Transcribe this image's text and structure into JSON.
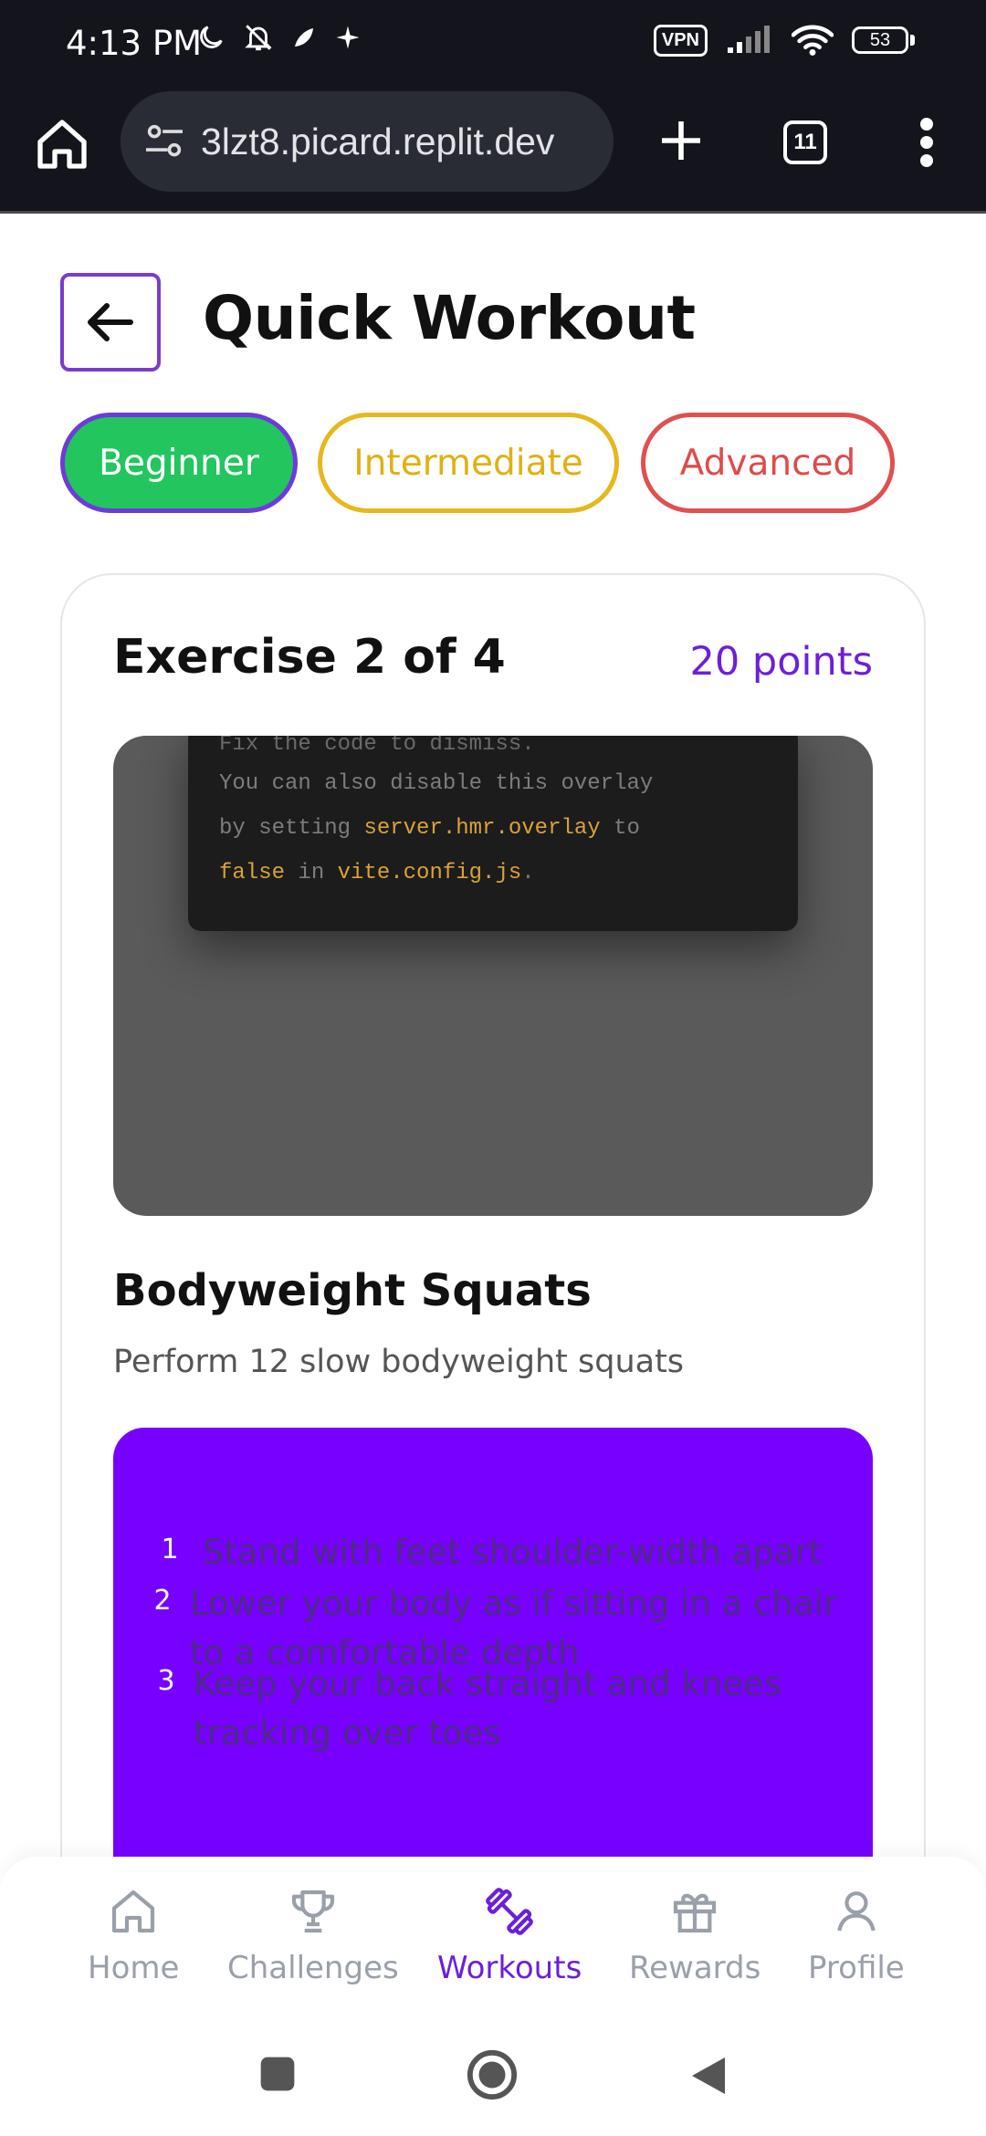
{
  "status_bar": {
    "time": "4:13 PM",
    "vpn_label": "VPN",
    "battery": "53",
    "icons": [
      "moon-icon",
      "bell-off-icon",
      "leaf-icon",
      "sparkle-icon",
      "signal-icon",
      "wifi-icon"
    ]
  },
  "browser": {
    "url": "3lzt8.picard.replit.dev",
    "tab_count": "11"
  },
  "page": {
    "title": "Quick Workout",
    "levels": [
      {
        "label": "Beginner",
        "selected": true,
        "color": "#22c55e"
      },
      {
        "label": "Intermediate",
        "selected": false,
        "color": "#e6b81c"
      },
      {
        "label": "Advanced",
        "selected": false,
        "color": "#e05050"
      }
    ]
  },
  "exercise": {
    "progress": "Exercise 2 of 4",
    "points": "20 points",
    "overlay": {
      "clipped_line": "Fix the code to dismiss.",
      "line1": "You can also disable this overlay",
      "line2_pre": "by setting ",
      "line2_code": "server.hmr.overlay",
      "line2_post": " to",
      "line3_code1": "false",
      "line3_mid": " in ",
      "line3_code2": "vite.config.js",
      "line3_end": "."
    },
    "name": "Bodyweight Squats",
    "description": "Perform 12 slow bodyweight squats",
    "steps": [
      {
        "num": "1",
        "text": "Stand with feet shoulder-width apart"
      },
      {
        "num": "2",
        "text": "Lower your body as if sitting in a chair",
        "text2": "to a comfortable depth"
      },
      {
        "num": "3",
        "text": "Keep your back straight and knees",
        "text2": "tracking over toes"
      }
    ]
  },
  "bottom_nav": {
    "items": [
      {
        "label": "Home",
        "icon": "home-icon",
        "active": false
      },
      {
        "label": "Challenges",
        "icon": "trophy-icon",
        "active": false
      },
      {
        "label": "Workouts",
        "icon": "dumbbell-icon",
        "active": true
      },
      {
        "label": "Rewards",
        "icon": "gift-icon",
        "active": false
      },
      {
        "label": "Profile",
        "icon": "user-icon",
        "active": false
      }
    ]
  },
  "colors": {
    "accent": "#6d1fd8",
    "steps_bg": "#7700ff",
    "browser_bg": "#14151c"
  }
}
